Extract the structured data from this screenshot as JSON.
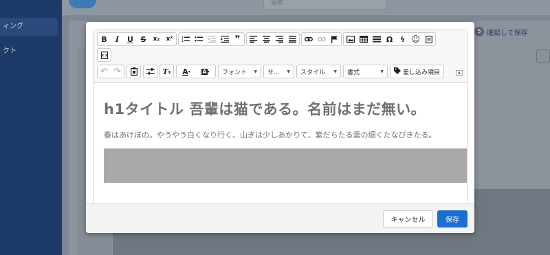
{
  "background": {
    "sidebar_items": [
      "ィング",
      "クト"
    ],
    "search_placeholder": "検索",
    "badge_count": "5",
    "confirm_save_label": "確認して保存"
  },
  "toolbar": {
    "row1": [
      {
        "icon": "bold-icon",
        "glyph": "B"
      },
      {
        "icon": "italic-icon",
        "glyph": "I"
      },
      {
        "icon": "underline-icon",
        "glyph": "U"
      },
      {
        "icon": "strikethrough-icon",
        "glyph": "S"
      },
      {
        "icon": "subscript-icon",
        "glyph": "x₂"
      },
      {
        "icon": "superscript-icon",
        "glyph": "x²"
      }
    ],
    "font_label": "フォント",
    "size_label": "サ...",
    "style_label": "スタイル",
    "format_label": "書式",
    "merge_field_label": "差し込み項目"
  },
  "content": {
    "heading": "h1タイトル 吾輩は猫である。名前はまだ無い。",
    "paragraph": "春はあけぼの。やうやう白くなり行く、山ぎは少しあかりて、紫だちたる雲の細くたなびきたる。"
  },
  "footer": {
    "cancel_label": "キャンセル",
    "save_label": "保存"
  },
  "colors": {
    "primary": "#1b6fd1",
    "text_gray": "#707070",
    "block_gray": "#a9a9a9"
  }
}
